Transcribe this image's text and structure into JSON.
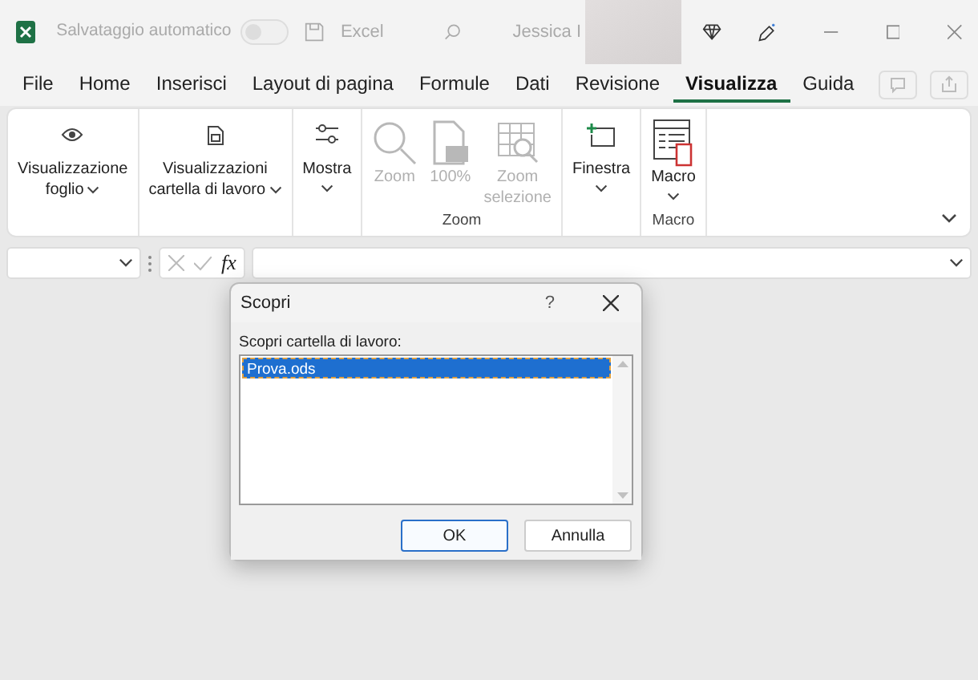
{
  "title_bar": {
    "autosave_label": "Salvataggio automatico",
    "autosave_on": false,
    "app_name": "Excel",
    "user_name": "Jessica I"
  },
  "menu_tabs": [
    {
      "label": "File",
      "selected": false
    },
    {
      "label": "Home",
      "selected": false
    },
    {
      "label": "Inserisci",
      "selected": false
    },
    {
      "label": "Layout di pagina",
      "selected": false
    },
    {
      "label": "Formule",
      "selected": false
    },
    {
      "label": "Dati",
      "selected": false
    },
    {
      "label": "Revisione",
      "selected": false
    },
    {
      "label": "Visualizza",
      "selected": true
    },
    {
      "label": "Guida",
      "selected": false
    }
  ],
  "ribbon_groups": [
    {
      "items": [
        {
          "kind": "eye",
          "lines": [
            "Visualizzazione",
            "foglio"
          ],
          "dropdown": true,
          "disabled": false
        }
      ]
    },
    {
      "items": [
        {
          "kind": "workbook",
          "lines": [
            "Visualizzazioni",
            "cartella di lavoro"
          ],
          "dropdown": true,
          "disabled": false
        }
      ]
    },
    {
      "items": [
        {
          "kind": "show",
          "lines": [
            "Mostra"
          ],
          "dropdown": true,
          "disabled": false
        }
      ]
    },
    {
      "label": "Zoom",
      "items": [
        {
          "kind": "zoom",
          "lines": [
            "Zoom"
          ],
          "dropdown": false,
          "disabled": true
        },
        {
          "kind": "page",
          "lines": [
            "100%"
          ],
          "dropdown": false,
          "disabled": true
        },
        {
          "kind": "zoom-selection",
          "lines": [
            "Zoom",
            "selezione"
          ],
          "dropdown": false,
          "disabled": true
        }
      ]
    },
    {
      "items": [
        {
          "kind": "window",
          "lines": [
            "Finestra"
          ],
          "dropdown": true,
          "disabled": false
        }
      ]
    },
    {
      "label": "Macro",
      "items": [
        {
          "kind": "macro",
          "lines": [
            "Macro"
          ],
          "dropdown": true,
          "disabled": false
        }
      ]
    }
  ],
  "formula_bar": {
    "fx": "fx"
  },
  "dialog": {
    "title": "Scopri",
    "help": "?",
    "list_label": "Scopri cartella di lavoro:",
    "workbooks": [
      {
        "name": "Prova.ods",
        "selected": true
      }
    ],
    "buttons": [
      {
        "label": "OK",
        "default": true
      },
      {
        "label": "Annulla",
        "default": false
      }
    ]
  }
}
